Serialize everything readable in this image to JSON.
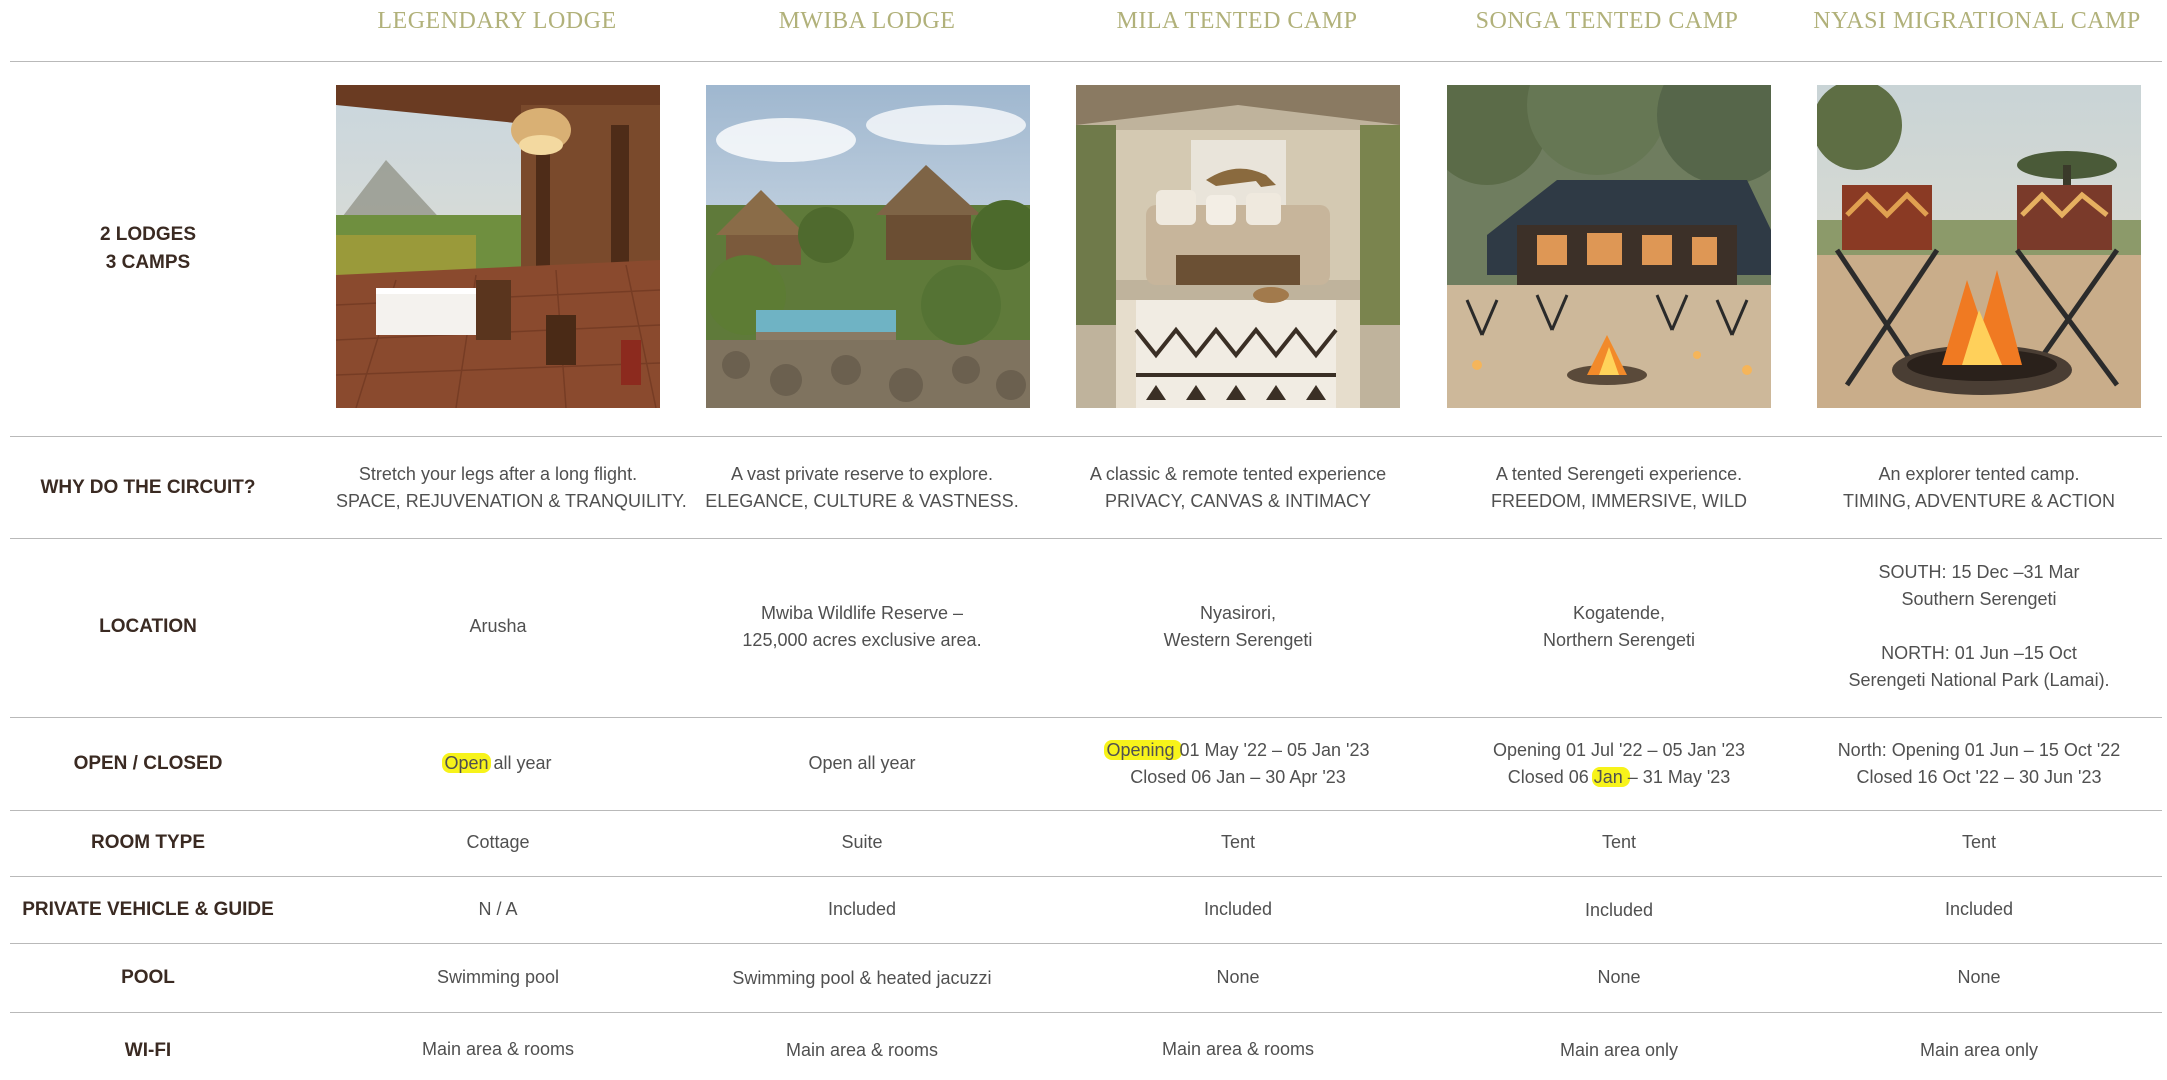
{
  "columns": [
    {
      "name": "LEGENDARY LODGE"
    },
    {
      "name": "MWIBA LODGE"
    },
    {
      "name": "MILA TENTED CAMP"
    },
    {
      "name": "SONGA TENTED CAMP"
    },
    {
      "name": "NYASI MIGRATIONAL CAMP"
    }
  ],
  "summary": {
    "line1": "2 LODGES",
    "line2": "3 CAMPS"
  },
  "photos": [
    {
      "name": "legendary-lodge-photo"
    },
    {
      "name": "mwiba-lodge-photo"
    },
    {
      "name": "mila-tented-camp-photo"
    },
    {
      "name": "songa-tented-camp-photo"
    },
    {
      "name": "nyasi-migrational-camp-photo"
    }
  ],
  "rows": {
    "why": {
      "label": "WHY DO THE CIRCUIT?",
      "cells": [
        {
          "line1": "Stretch your legs after a long flight.",
          "line2": "SPACE, REJUVENATION & TRANQUILITY."
        },
        {
          "line1": "A vast private reserve to explore.",
          "line2": "ELEGANCE, CULTURE & VASTNESS."
        },
        {
          "line1": "A classic & remote tented experience",
          "line2": "PRIVACY, CANVAS & INTIMACY"
        },
        {
          "line1": "A tented Serengeti experience.",
          "line2": "FREEDOM, IMMERSIVE, WILD"
        },
        {
          "line1": "An explorer tented camp.",
          "line2": "TIMING, ADVENTURE & ACTION"
        }
      ]
    },
    "location": {
      "label": "LOCATION",
      "cells": [
        {
          "line1": "Arusha"
        },
        {
          "line1": "Mwiba Wildlife Reserve –",
          "line2": "125,000 acres exclusive area."
        },
        {
          "line1": "Nyasirori,",
          "line2": "Western Serengeti"
        },
        {
          "line1": "Kogatende,",
          "line2": "Northern Serengeti"
        },
        {
          "line1": "SOUTH: 15 Dec –31 Mar",
          "line2": "Southern Serengeti",
          "line3": "NORTH: 01 Jun –15 Oct",
          "line4": "Serengeti National Park (Lamai)."
        }
      ]
    },
    "open": {
      "label": "OPEN / CLOSED",
      "cells": [
        {
          "hl": "Open",
          "rest": " all year"
        },
        {
          "line1": "Open all year"
        },
        {
          "hl": "Opening ",
          "rest": "01 May '22 – 05 Jan '23",
          "line2": "Closed 06 Jan – 30 Apr '23"
        },
        {
          "line1": "Opening 01 Jul '22 – 05 Jan '23",
          "pre": "Closed 06 ",
          "hl": "Jan ",
          "post": "– 31 May '23"
        },
        {
          "line1": "North: Opening 01 Jun – 15 Oct '22",
          "line2": "Closed 16 Oct '22 – 30 Jun '23"
        }
      ]
    },
    "room": {
      "label": "ROOM TYPE",
      "cells": [
        "Cottage",
        "Suite",
        "Tent",
        "Tent",
        "Tent"
      ]
    },
    "vehicle": {
      "label": "PRIVATE VEHICLE & GUIDE",
      "cells": [
        "N / A",
        "Included",
        "Included",
        "Included",
        "Included"
      ]
    },
    "pool": {
      "label": "POOL",
      "cells": [
        "Swimming pool",
        "Swimming pool & heated jacuzzi",
        "None",
        "None",
        "None"
      ]
    },
    "wifi": {
      "label": "WI-FI",
      "cells": [
        "Main area & rooms",
        "Main area & rooms",
        "Main area & rooms",
        "Main area only",
        "Main area only"
      ]
    }
  },
  "colors": {
    "header_text": "#b1b17a",
    "label_text": "#3a2a22",
    "body_text": "#505050",
    "rule": "#b9b9b9",
    "highlight": "#f7f31a"
  }
}
